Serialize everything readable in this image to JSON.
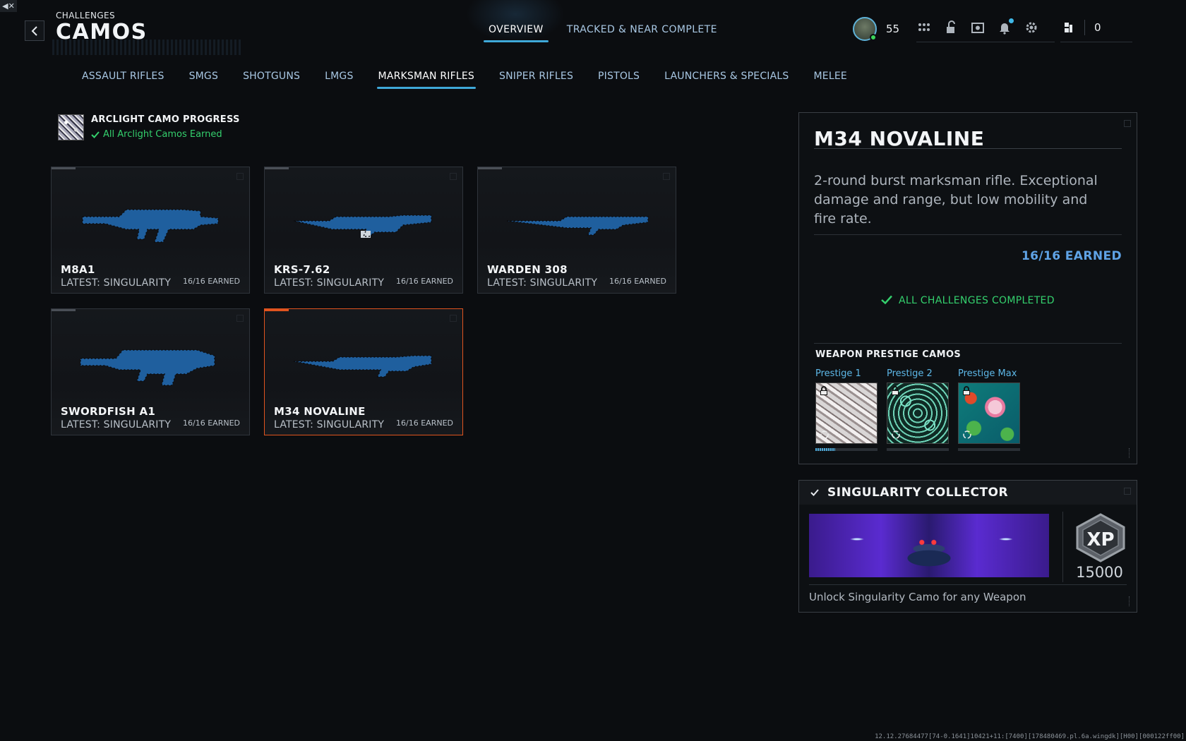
{
  "header": {
    "eyebrow": "CHALLENGES",
    "title": "CAMOS",
    "back_icon": "chevron-left-icon",
    "mute_icon": "speaker-muted-icon"
  },
  "top_tabs": [
    {
      "label": "OVERVIEW",
      "active": true
    },
    {
      "label": "TRACKED & NEAR COMPLETE",
      "active": false
    }
  ],
  "hud": {
    "player_level": "55",
    "icons": [
      "apps-grid-icon",
      "unlock-icon",
      "store-icon",
      "bell-icon",
      "gear-icon"
    ],
    "currency_icon": "cod-points-icon",
    "currency_value": "0",
    "accent_color": "#3fa9d9"
  },
  "category_tabs": [
    {
      "label": "ASSAULT RIFLES",
      "active": false
    },
    {
      "label": "SMGS",
      "active": false
    },
    {
      "label": "SHOTGUNS",
      "active": false
    },
    {
      "label": "LMGS",
      "active": false
    },
    {
      "label": "MARKSMAN RIFLES",
      "active": true
    },
    {
      "label": "SNIPER RIFLES",
      "active": false
    },
    {
      "label": "PISTOLS",
      "active": false
    },
    {
      "label": "LAUNCHERS & SPECIALS",
      "active": false
    },
    {
      "label": "MELEE",
      "active": false
    }
  ],
  "camo_progress": {
    "title": "ARCLIGHT CAMO PROGRESS",
    "status": "All Arclight Camos Earned",
    "status_color": "#34d06d"
  },
  "weapons": [
    {
      "name": "M8A1",
      "latest": "LATEST: SINGULARITY",
      "earned": "16/16 EARNED",
      "selected": false
    },
    {
      "name": "KRS-7.62",
      "latest": "LATEST: SINGULARITY",
      "earned": "16/16 EARNED",
      "selected": false
    },
    {
      "name": "WARDEN 308",
      "latest": "LATEST: SINGULARITY",
      "earned": "16/16 EARNED",
      "selected": false
    },
    {
      "name": "SWORDFISH A1",
      "latest": "LATEST: SINGULARITY",
      "earned": "16/16 EARNED",
      "selected": false
    },
    {
      "name": "M34 NOVALINE",
      "latest": "LATEST: SINGULARITY",
      "earned": "16/16 EARNED",
      "selected": true
    }
  ],
  "detail": {
    "name": "M34 NOVALINE",
    "description": "2-round burst marksman rifle. Exceptional damage and range, but low mobility and fire rate.",
    "earned": "16/16 EARNED",
    "earned_color": "#5fa3e6",
    "completed": "ALL CHALLENGES COMPLETED",
    "prestige_title": "WEAPON PRESTIGE CAMOS",
    "prestige": [
      {
        "label": "Prestige 1",
        "locked": true,
        "progress": 0.32
      },
      {
        "label": "Prestige 2",
        "locked": true,
        "progress": 0
      },
      {
        "label": "Prestige Max",
        "locked": true,
        "progress": 0
      }
    ]
  },
  "reward": {
    "title": "SINGULARITY COLLECTOR",
    "xp_badge": "XP",
    "xp_value": "15000",
    "description": "Unlock Singularity Camo for any Weapon"
  },
  "selected_color": "#e0541f",
  "build_string": "12.12.27684477[74-0.1641]10421+11:[7400][178480469.pl.6a.wingdk][H00][000122ff00]"
}
